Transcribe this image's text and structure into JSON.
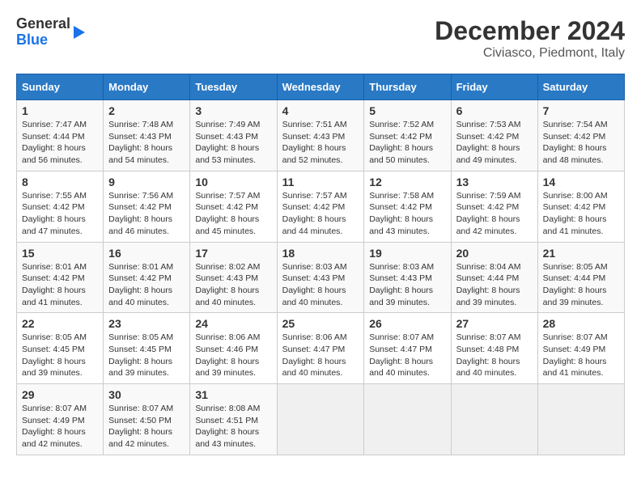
{
  "logo": {
    "line1": "General",
    "line2": "Blue"
  },
  "title": "December 2024",
  "subtitle": "Civiasco, Piedmont, Italy",
  "headers": [
    "Sunday",
    "Monday",
    "Tuesday",
    "Wednesday",
    "Thursday",
    "Friday",
    "Saturday"
  ],
  "weeks": [
    [
      {
        "day": "1",
        "sunrise": "7:47 AM",
        "sunset": "4:44 PM",
        "daylight": "8 hours and 56 minutes."
      },
      {
        "day": "2",
        "sunrise": "7:48 AM",
        "sunset": "4:43 PM",
        "daylight": "8 hours and 54 minutes."
      },
      {
        "day": "3",
        "sunrise": "7:49 AM",
        "sunset": "4:43 PM",
        "daylight": "8 hours and 53 minutes."
      },
      {
        "day": "4",
        "sunrise": "7:51 AM",
        "sunset": "4:43 PM",
        "daylight": "8 hours and 52 minutes."
      },
      {
        "day": "5",
        "sunrise": "7:52 AM",
        "sunset": "4:42 PM",
        "daylight": "8 hours and 50 minutes."
      },
      {
        "day": "6",
        "sunrise": "7:53 AM",
        "sunset": "4:42 PM",
        "daylight": "8 hours and 49 minutes."
      },
      {
        "day": "7",
        "sunrise": "7:54 AM",
        "sunset": "4:42 PM",
        "daylight": "8 hours and 48 minutes."
      }
    ],
    [
      {
        "day": "8",
        "sunrise": "7:55 AM",
        "sunset": "4:42 PM",
        "daylight": "8 hours and 47 minutes."
      },
      {
        "day": "9",
        "sunrise": "7:56 AM",
        "sunset": "4:42 PM",
        "daylight": "8 hours and 46 minutes."
      },
      {
        "day": "10",
        "sunrise": "7:57 AM",
        "sunset": "4:42 PM",
        "daylight": "8 hours and 45 minutes."
      },
      {
        "day": "11",
        "sunrise": "7:57 AM",
        "sunset": "4:42 PM",
        "daylight": "8 hours and 44 minutes."
      },
      {
        "day": "12",
        "sunrise": "7:58 AM",
        "sunset": "4:42 PM",
        "daylight": "8 hours and 43 minutes."
      },
      {
        "day": "13",
        "sunrise": "7:59 AM",
        "sunset": "4:42 PM",
        "daylight": "8 hours and 42 minutes."
      },
      {
        "day": "14",
        "sunrise": "8:00 AM",
        "sunset": "4:42 PM",
        "daylight": "8 hours and 41 minutes."
      }
    ],
    [
      {
        "day": "15",
        "sunrise": "8:01 AM",
        "sunset": "4:42 PM",
        "daylight": "8 hours and 41 minutes."
      },
      {
        "day": "16",
        "sunrise": "8:01 AM",
        "sunset": "4:42 PM",
        "daylight": "8 hours and 40 minutes."
      },
      {
        "day": "17",
        "sunrise": "8:02 AM",
        "sunset": "4:43 PM",
        "daylight": "8 hours and 40 minutes."
      },
      {
        "day": "18",
        "sunrise": "8:03 AM",
        "sunset": "4:43 PM",
        "daylight": "8 hours and 40 minutes."
      },
      {
        "day": "19",
        "sunrise": "8:03 AM",
        "sunset": "4:43 PM",
        "daylight": "8 hours and 39 minutes."
      },
      {
        "day": "20",
        "sunrise": "8:04 AM",
        "sunset": "4:44 PM",
        "daylight": "8 hours and 39 minutes."
      },
      {
        "day": "21",
        "sunrise": "8:05 AM",
        "sunset": "4:44 PM",
        "daylight": "8 hours and 39 minutes."
      }
    ],
    [
      {
        "day": "22",
        "sunrise": "8:05 AM",
        "sunset": "4:45 PM",
        "daylight": "8 hours and 39 minutes."
      },
      {
        "day": "23",
        "sunrise": "8:05 AM",
        "sunset": "4:45 PM",
        "daylight": "8 hours and 39 minutes."
      },
      {
        "day": "24",
        "sunrise": "8:06 AM",
        "sunset": "4:46 PM",
        "daylight": "8 hours and 39 minutes."
      },
      {
        "day": "25",
        "sunrise": "8:06 AM",
        "sunset": "4:47 PM",
        "daylight": "8 hours and 40 minutes."
      },
      {
        "day": "26",
        "sunrise": "8:07 AM",
        "sunset": "4:47 PM",
        "daylight": "8 hours and 40 minutes."
      },
      {
        "day": "27",
        "sunrise": "8:07 AM",
        "sunset": "4:48 PM",
        "daylight": "8 hours and 40 minutes."
      },
      {
        "day": "28",
        "sunrise": "8:07 AM",
        "sunset": "4:49 PM",
        "daylight": "8 hours and 41 minutes."
      }
    ],
    [
      {
        "day": "29",
        "sunrise": "8:07 AM",
        "sunset": "4:49 PM",
        "daylight": "8 hours and 42 minutes."
      },
      {
        "day": "30",
        "sunrise": "8:07 AM",
        "sunset": "4:50 PM",
        "daylight": "8 hours and 42 minutes."
      },
      {
        "day": "31",
        "sunrise": "8:08 AM",
        "sunset": "4:51 PM",
        "daylight": "8 hours and 43 minutes."
      },
      null,
      null,
      null,
      null
    ]
  ],
  "labels": {
    "sunrise": "Sunrise:",
    "sunset": "Sunset:",
    "daylight": "Daylight:"
  }
}
